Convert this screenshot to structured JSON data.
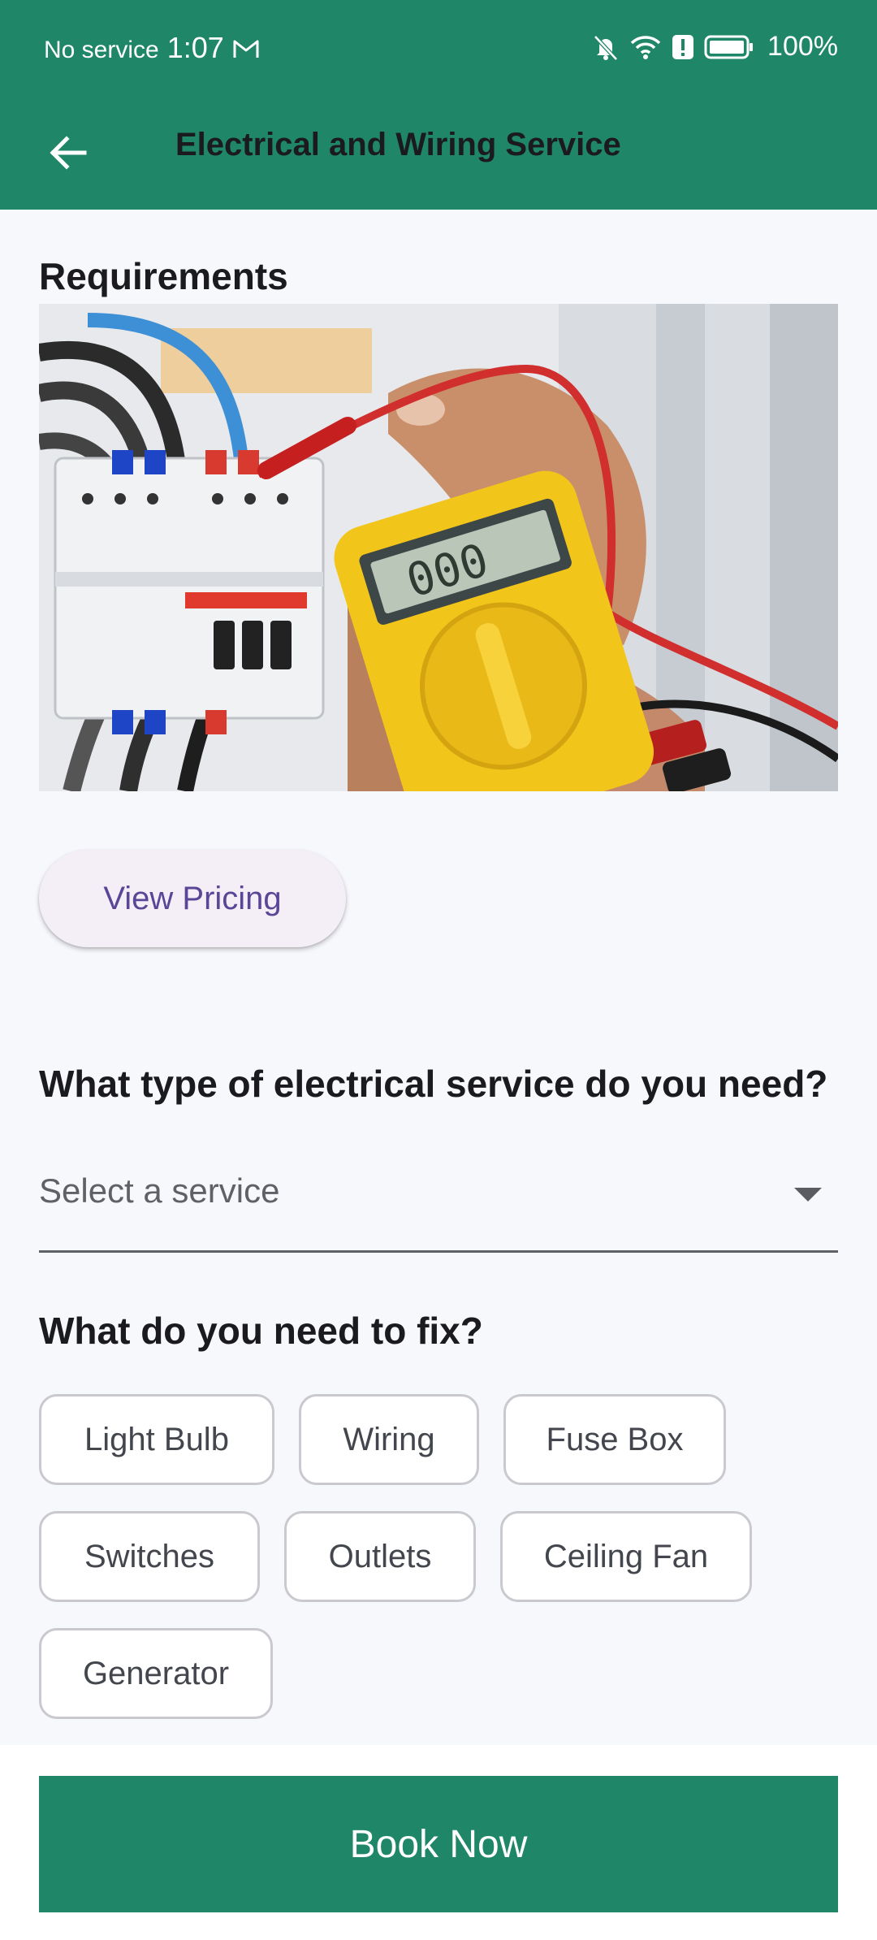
{
  "status_bar": {
    "carrier": "No service",
    "time": "1:07",
    "battery": "100%",
    "icons": [
      "gmail-icon",
      "bell-off-icon",
      "wifi-icon",
      "alert-icon",
      "battery-icon"
    ]
  },
  "app_bar": {
    "back_icon": "arrow-back-icon",
    "title": "Electrical and Wiring Service"
  },
  "requirements": {
    "heading": "Requirements",
    "image_alt": "Electrician testing a circuit breaker with a yellow multimeter"
  },
  "pricing_button": {
    "label": "View Pricing"
  },
  "service_question": {
    "heading": "What type of electrical service do you need?",
    "dropdown_value": "Select a service",
    "dropdown_icon": "arrow-drop-down-icon"
  },
  "fix_question": {
    "heading": "What do you need to fix?",
    "rows": [
      [
        "Light Bulb",
        "Wiring",
        "Fuse Box"
      ],
      [
        "Switches",
        "Outlets",
        "Ceiling Fan"
      ],
      [
        "Generator"
      ]
    ]
  },
  "book_button": {
    "label": "Book Now"
  },
  "colors": {
    "primary": "#1f8767",
    "background": "#f7f8fc",
    "pricing_text": "#5a4597",
    "pricing_bg": "#f4eff6"
  }
}
